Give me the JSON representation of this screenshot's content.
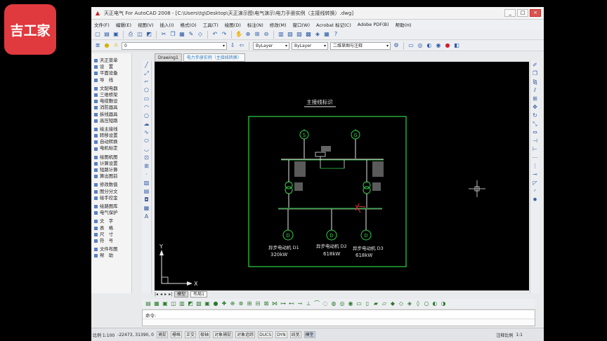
{
  "overlay_logo": "吉工家",
  "window": {
    "title": "天正电气 For AutoCAD 2008 - [C:\\Users\\tg\\Desktop\\天正演示图\\电气演示\\电力手册实例（主接线转换）.dwg]",
    "controls": [
      "_",
      "□",
      "×"
    ]
  },
  "menubar": [
    "文件(F)",
    "编辑(E)",
    "视图(V)",
    "插入(I)",
    "格式(O)",
    "工具(T)",
    "绘图(D)",
    "标注(N)",
    "修改(M)",
    "窗口(W)",
    "Acrobat 标记(C)",
    "Adobe PDF(B)",
    "帮助(H)"
  ],
  "toolbar2": {
    "layer_value": "0",
    "layer2_value": "ByLayer",
    "linetype_value": "ByLayer",
    "workspace_value": "二维草图与注释",
    "color_value": "ByLayer"
  },
  "tabs": [
    "Drawing1",
    "电力手册实例（主接线转换）"
  ],
  "leftmenu": {
    "groups": [
      [
        "天正菜单",
        "设　置",
        "平面设备",
        "导　线"
      ],
      [
        "文配电器",
        "三维桥架",
        "电缆敷设",
        "消防器具",
        "拆线器具",
        "高压短路"
      ],
      [
        "绘主接线",
        "转移设置",
        "自动转换",
        "电机标定"
      ],
      [
        "绘图机图",
        "计算设置",
        "短路计算",
        "算出图前"
      ],
      [
        "修改数值",
        "图分分文",
        "绘手控金"
      ],
      [
        "绘路图库",
        "电气保护"
      ],
      [
        "文　字",
        "表　格",
        "尺　寸",
        "符　号"
      ],
      [
        "文件布图",
        "帮　助"
      ]
    ]
  },
  "drawing": {
    "title": "主接线标识",
    "sources": [
      {
        "symbol": "S"
      },
      {
        "symbol": "G"
      }
    ],
    "motors": [
      {
        "symbol": "D",
        "label": "异步电动机 D1",
        "power": "320kW"
      },
      {
        "symbol": "D",
        "label": "异步电动机 D2",
        "power": "618kW"
      },
      {
        "symbol": "D",
        "label": "异步电动机 D3",
        "power": "618kW"
      }
    ],
    "ucs_y": "Y",
    "ucs_x": "X"
  },
  "model_tabs": [
    "模型",
    "布局1"
  ],
  "command": {
    "prompt": "命令:"
  },
  "status": {
    "scale": "比例 1:100",
    "coords": "-22473, 31390, 0",
    "toggles": [
      "捕捉",
      "栅格",
      "正交",
      "极轴",
      "对象捕捉",
      "对象追踪",
      "DUCS",
      "DYN",
      "线宽",
      "模型"
    ],
    "anno_label": "注释比例",
    "anno_value": "1:1"
  },
  "colors": {
    "frame": "#2fd14a",
    "drawing_line": "#e8e8e8",
    "break_mark": "#e0323a",
    "logo_bg": "#e0393e"
  }
}
